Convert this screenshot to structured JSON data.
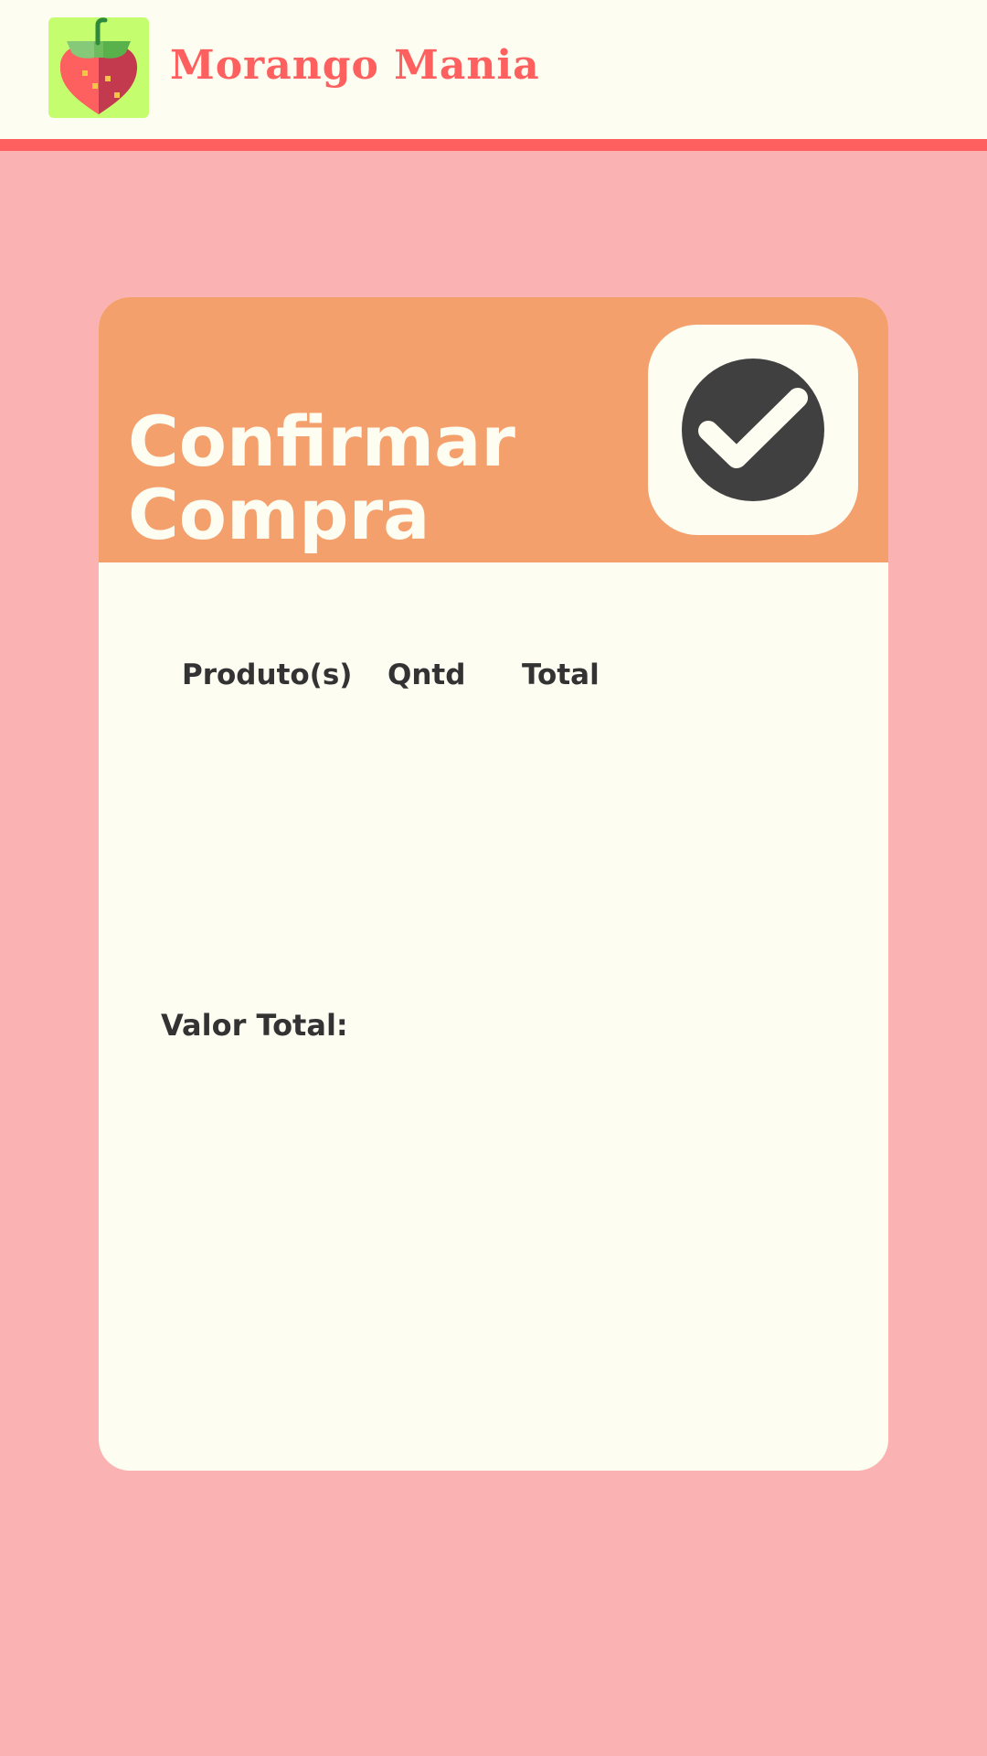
{
  "header": {
    "brand": "Morango Mania",
    "logo_icon": "strawberry-icon"
  },
  "card": {
    "title": "Confirmar Compra",
    "confirm_icon": "check-circle-icon",
    "columns": [
      "Produto(s)",
      "Qntd",
      "Total"
    ],
    "total_label": "Valor Total:"
  },
  "colors": {
    "background": "#fab2b2",
    "header_bg": "#fefdf1",
    "accent": "#fe5f5f",
    "card_header": "#f3a06d",
    "logo_bg": "#c4fe6f",
    "text": "#333333"
  }
}
